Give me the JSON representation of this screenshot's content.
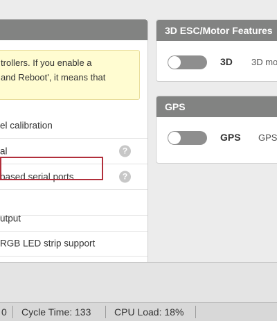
{
  "warning": {
    "line1": "trollers. If you enable a",
    "line2": "and Reboot', it means that"
  },
  "features": [
    {
      "label": "el calibration",
      "help": false
    },
    {
      "label": "al",
      "help": true
    },
    {
      "label": " based serial ports",
      "help": true
    },
    {
      "label": "",
      "help": false
    },
    {
      "label": "utput",
      "help": false
    },
    {
      "label": "RGB LED strip support",
      "help": false
    }
  ],
  "help_glyph": "?",
  "esc_panel": {
    "title": "3D ESC/Motor Features",
    "toggle_label": "3D",
    "toggle_desc": "3D mo",
    "enabled": false
  },
  "gps_panel": {
    "title": "GPS",
    "toggle_label": "GPS",
    "toggle_desc": "GPS",
    "enabled": false
  },
  "status": {
    "left_fragment": "0",
    "cycle_time": "Cycle Time: 133",
    "cpu_load": "CPU Load: 18%"
  },
  "colors": {
    "header": "#828382",
    "warning_bg": "#fffcd1",
    "highlight": "#b12f3b",
    "toggle_off": "#8e8e8e"
  },
  "icons": [
    "help-icon"
  ]
}
